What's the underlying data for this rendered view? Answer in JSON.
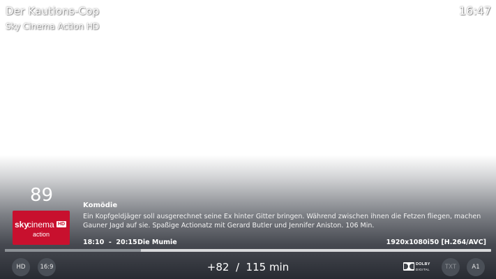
{
  "top": {
    "show_title": "Der Kautions-Cop",
    "channel_name": "Sky Cinema Action HD",
    "clock": "16:47"
  },
  "osd": {
    "channel_number": "89",
    "logo": {
      "sky": "sky",
      "cinema": "cinema",
      "hd": "HD",
      "action": "action",
      "brand_color": "#c8102e"
    },
    "genre": "Komödie",
    "plot": "Ein Kopfgeldjäger soll ausgerechnet seine Ex hinter Gitter bringen. Während zwischen ihnen die Fetzen fliegen, machen Gauner Jagd auf sie. Spaßige Actionatz mit Gerard Butler und Jennifer Aniston. 106 Min.",
    "time_range": "18:10  -  20:15",
    "next_title": "Die Mumie",
    "resolution": "1920x1080i50 [H.264/AVC]",
    "progress_percent": 28,
    "remaining": "+82  /  115 min",
    "badges": {
      "hd": "HD",
      "aspect": "16:9",
      "txt": "TXT",
      "audio": "A1"
    },
    "dolby": {
      "word": "DOLBY",
      "digital": "DIGITAL"
    }
  }
}
